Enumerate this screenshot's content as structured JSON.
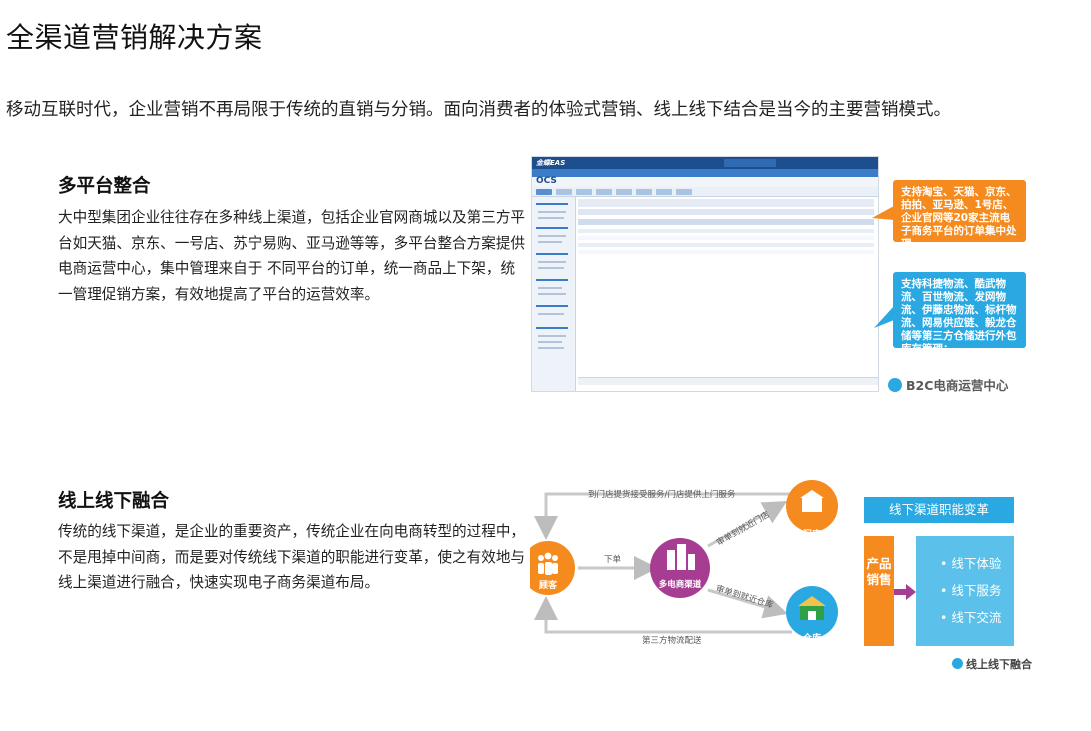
{
  "page_title": "全渠道营销解决方案",
  "intro": "移动互联时代，企业营销不再局限于传统的直销与分销。面向消费者的体验式营销、线上线下结合是当今的主要营销模式。",
  "sections": [
    {
      "heading": "多平台整合",
      "body": "大中型集团企业往往存在多种线上渠道，包括企业官网商城以及第三方平台如天猫、京东、一号店、苏宁易购、亚马逊等等，多平台整合方案提供电商运营中心，集中管理来自于 不同平台的订单，统一商品上下架，统一管理促销方案，有效地提高了平台的运营效率。"
    },
    {
      "heading": "线上线下融合",
      "body": "传统的线下渠道，是企业的重要资产，传统企业在向电商转型的过程中，不是甩掉中间商，而是要对传统线下渠道的职能进行变革，使之有效地与线上渠道进行融合，快速实现电子商务渠道布局。"
    }
  ],
  "screenshot": {
    "brand": "金蝶EAS",
    "module": "OCS",
    "callout_orange": "支持淘宝、天猫、京东、拍拍、亚马逊、1号店、企业官网等20家主流电子商务平台的订单集中处理",
    "callout_blue": "支持科捷物流、酷武物流、百世物流、发网物流、伊藤忠物流、标杆物流、网易供应链、毅龙仓储等第三方仓储进行外包库存管理；",
    "badge": "B2C电商运营中心"
  },
  "diagram": {
    "top_arrow": "到门店提货接受服务/门店提供上门服务",
    "bottom_arrow": "第三方物流配送",
    "order_label": "下单",
    "to_store": "审单到就近门店",
    "to_warehouse": "审单到就近仓库",
    "consumer": "顾客",
    "hub": "多电商渠道",
    "store": "门店",
    "warehouse": "仓库",
    "panel_title": "线下渠道职能变革",
    "panel_side": "产品销售",
    "panel_items": [
      "线下体验",
      "线下服务",
      "线下交流"
    ],
    "badge": "线上线下融合"
  },
  "colors": {
    "orange": "#f58a1e",
    "blue": "#29a8e2",
    "purple": "#a63d92",
    "green": "#2ea046",
    "eas_blue": "#1d4f8f"
  }
}
